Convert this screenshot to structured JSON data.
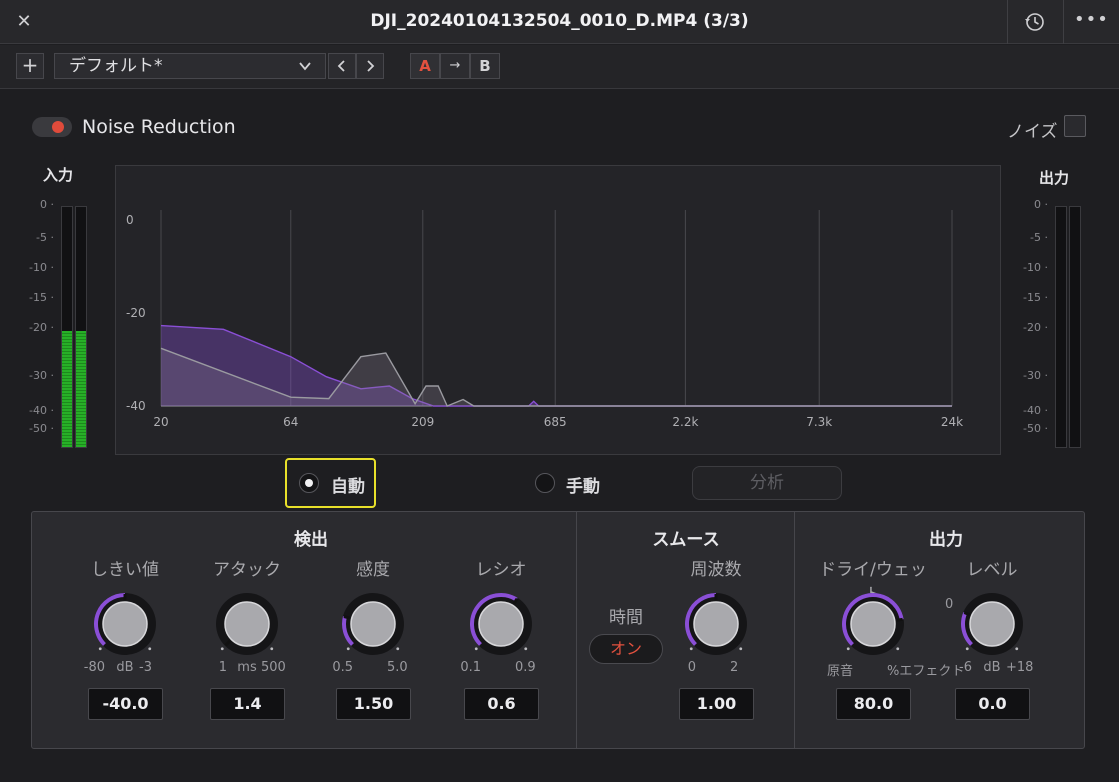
{
  "window": {
    "title": "DJI_20240104132504_0010_D.MP4 (3/3)",
    "close_glyph": "✕",
    "more_glyph": "•••"
  },
  "toolbar": {
    "add_glyph": "+",
    "preset": "デフォルト*",
    "prev_glyph": "‹",
    "next_glyph": "›",
    "a_label": "A",
    "copy_glyph": "→",
    "b_label": "B"
  },
  "plugin": {
    "title": "Noise Reduction",
    "enabled": true,
    "noise_label": "ノイズ",
    "noise_checked": false
  },
  "meters": {
    "input_title": "入力",
    "output_title": "出力",
    "scale": [
      "0",
      "-5",
      "-10",
      "-15",
      "-20",
      "-30",
      "-40",
      "-50"
    ],
    "input_level_db": -20,
    "output_level_db": -60
  },
  "colors": {
    "accent_red": "#e04b3b",
    "accent_purple": "#8a4fd6",
    "highlight_yellow": "#e8e02a",
    "meter_green": "#27b027"
  },
  "chart_data": {
    "type": "area",
    "x_tick_labels": [
      "20",
      "64",
      "209",
      "685",
      "2.2k",
      "7.3k",
      "24k"
    ],
    "x_ticks_hz": [
      20,
      64,
      209,
      685,
      2200,
      7300,
      24000
    ],
    "y_tick_labels": [
      "0",
      "-20",
      "-40"
    ],
    "ylim": [
      -40,
      0
    ],
    "x_scale": "log",
    "series": [
      {
        "color": "#8a4fd6",
        "points": [
          [
            20,
            -22.7
          ],
          [
            35,
            -23.5
          ],
          [
            64,
            -29.4
          ],
          [
            88,
            -33.7
          ],
          [
            120,
            -36.3
          ],
          [
            155,
            -35.7
          ],
          [
            190,
            -38.4
          ],
          [
            230,
            -40
          ],
          [
            330,
            -40
          ],
          [
            540,
            -40
          ],
          [
            565,
            -39
          ],
          [
            590,
            -40
          ],
          [
            24000,
            -40
          ]
        ]
      },
      {
        "color": "#9a9aa0",
        "points": [
          [
            20,
            -27.6
          ],
          [
            64,
            -38.1
          ],
          [
            90,
            -38.4
          ],
          [
            120,
            -29.4
          ],
          [
            150,
            -28.6
          ],
          [
            195,
            -39.5
          ],
          [
            215,
            -35.7
          ],
          [
            240,
            -35.7
          ],
          [
            260,
            -40
          ],
          [
            300,
            -38.6
          ],
          [
            330,
            -40
          ],
          [
            24000,
            -40
          ]
        ]
      }
    ]
  },
  "modes": {
    "auto": "自動",
    "manual": "手動",
    "selected": "auto",
    "analyze": "分析"
  },
  "sections": {
    "detection": {
      "title": "検出",
      "knobs": [
        {
          "label": "しきい値",
          "min": "-80",
          "unit": "dB",
          "max": "-3",
          "value": "-40.0",
          "fraction": 0.5
        },
        {
          "label": "アタック",
          "min": "1",
          "unit": "ms",
          "max": "500",
          "value": "1.4",
          "fraction": 0.0
        },
        {
          "label": "感度",
          "min": "0.5",
          "unit": "",
          "max": "5.0",
          "value": "1.50",
          "fraction": 0.22
        },
        {
          "label": "レシオ",
          "min": "0.1",
          "unit": "",
          "max": "0.9",
          "value": "0.6",
          "fraction": 0.62
        }
      ]
    },
    "smooth": {
      "title": "スムース",
      "time_label": "時間",
      "time_toggle": "オン",
      "knobs": [
        {
          "label": "周波数",
          "min": "0",
          "unit": "",
          "max": "2",
          "value": "1.00",
          "fraction": 0.5
        }
      ]
    },
    "output": {
      "title": "出力",
      "knobs": [
        {
          "label": "ドライ/ウェット",
          "min": "原音",
          "unit": "",
          "max": "%エフェクト",
          "value": "80.0",
          "fraction": 0.8
        },
        {
          "label": "レベル",
          "min": "-6",
          "unit": "dB",
          "max": "+18",
          "value": "0.0",
          "fraction": 0.25,
          "zero_mark": "0"
        }
      ]
    }
  }
}
